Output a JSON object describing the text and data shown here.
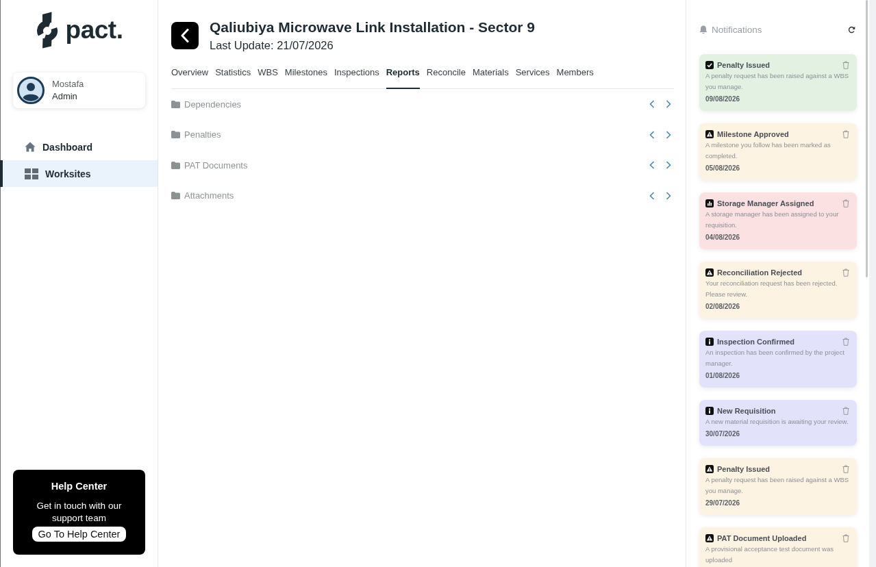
{
  "sidebar": {
    "logo": "pact.",
    "user": {
      "name": "Mostafa",
      "role": "Admin"
    },
    "nav": [
      {
        "label": "Dashboard",
        "kind": "home",
        "selected": false
      },
      {
        "label": "Worksites",
        "kind": "grid",
        "selected": true
      }
    ],
    "help": {
      "title": "Help Center",
      "text": "Get in touch with our support team",
      "button": "Go To Help Center"
    }
  },
  "header": {
    "title": "Qaliubiya Microwave Link Installation - Sector 9",
    "subtitle": "Last Update: 21/07/2026"
  },
  "tabs": [
    {
      "label": "Overview",
      "selected": false
    },
    {
      "label": "Statistics",
      "selected": false
    },
    {
      "label": "WBS",
      "selected": false
    },
    {
      "label": "Milestones",
      "selected": false
    },
    {
      "label": "Inspections",
      "selected": false
    },
    {
      "label": "Reports",
      "selected": true
    },
    {
      "label": "Reconcile",
      "selected": false
    },
    {
      "label": "Materials",
      "selected": false
    },
    {
      "label": "Services",
      "selected": false
    },
    {
      "label": "Members",
      "selected": false
    }
  ],
  "sections": [
    {
      "label": "Dependencies"
    },
    {
      "label": "Penalties"
    },
    {
      "label": "PAT Documents"
    },
    {
      "label": "Attachments"
    }
  ],
  "notifications": {
    "title": "Notifications",
    "items": [
      {
        "kind": "success",
        "color": "#e3f1e3",
        "title": "Penalty Issued",
        "text": "A penalty request has been raised against a WBS you manage.",
        "date": "09/08/2026"
      },
      {
        "kind": "warning",
        "color": "#fdf3e2",
        "title": "Milestone Approved",
        "text": "A milestone you follow has been marked as completed.",
        "date": "05/08/2026"
      },
      {
        "kind": "chart",
        "color": "#fbe1e1",
        "title": "Storage Manager Assigned",
        "text": "A storage manager has been assigned to your requisition.",
        "date": "04/08/2026"
      },
      {
        "kind": "warning",
        "color": "#fdf3e2",
        "title": "Reconciliation Rejected",
        "text": "Your reconciliation request has been rejected. Please review.",
        "date": "02/08/2026"
      },
      {
        "kind": "info",
        "color": "#e2e3fa",
        "title": "Inspection Confirmed",
        "text": "An inspection has been confirmed by the project manager.",
        "date": "01/08/2026"
      },
      {
        "kind": "info",
        "color": "#e2e3fa",
        "title": "New Requisition",
        "text": "A new material requisition is awaiting your review.",
        "date": "30/07/2026"
      },
      {
        "kind": "warning",
        "color": "#fdf3e2",
        "title": "Penalty Issued",
        "text": "A penalty request has been raised against a WBS you manage.",
        "date": "29/07/2026"
      },
      {
        "kind": "warning",
        "color": "#fdf3e2",
        "title": "PAT Document Uploaded",
        "text": "A provisional acceptance test document was uploaded"
      }
    ]
  }
}
